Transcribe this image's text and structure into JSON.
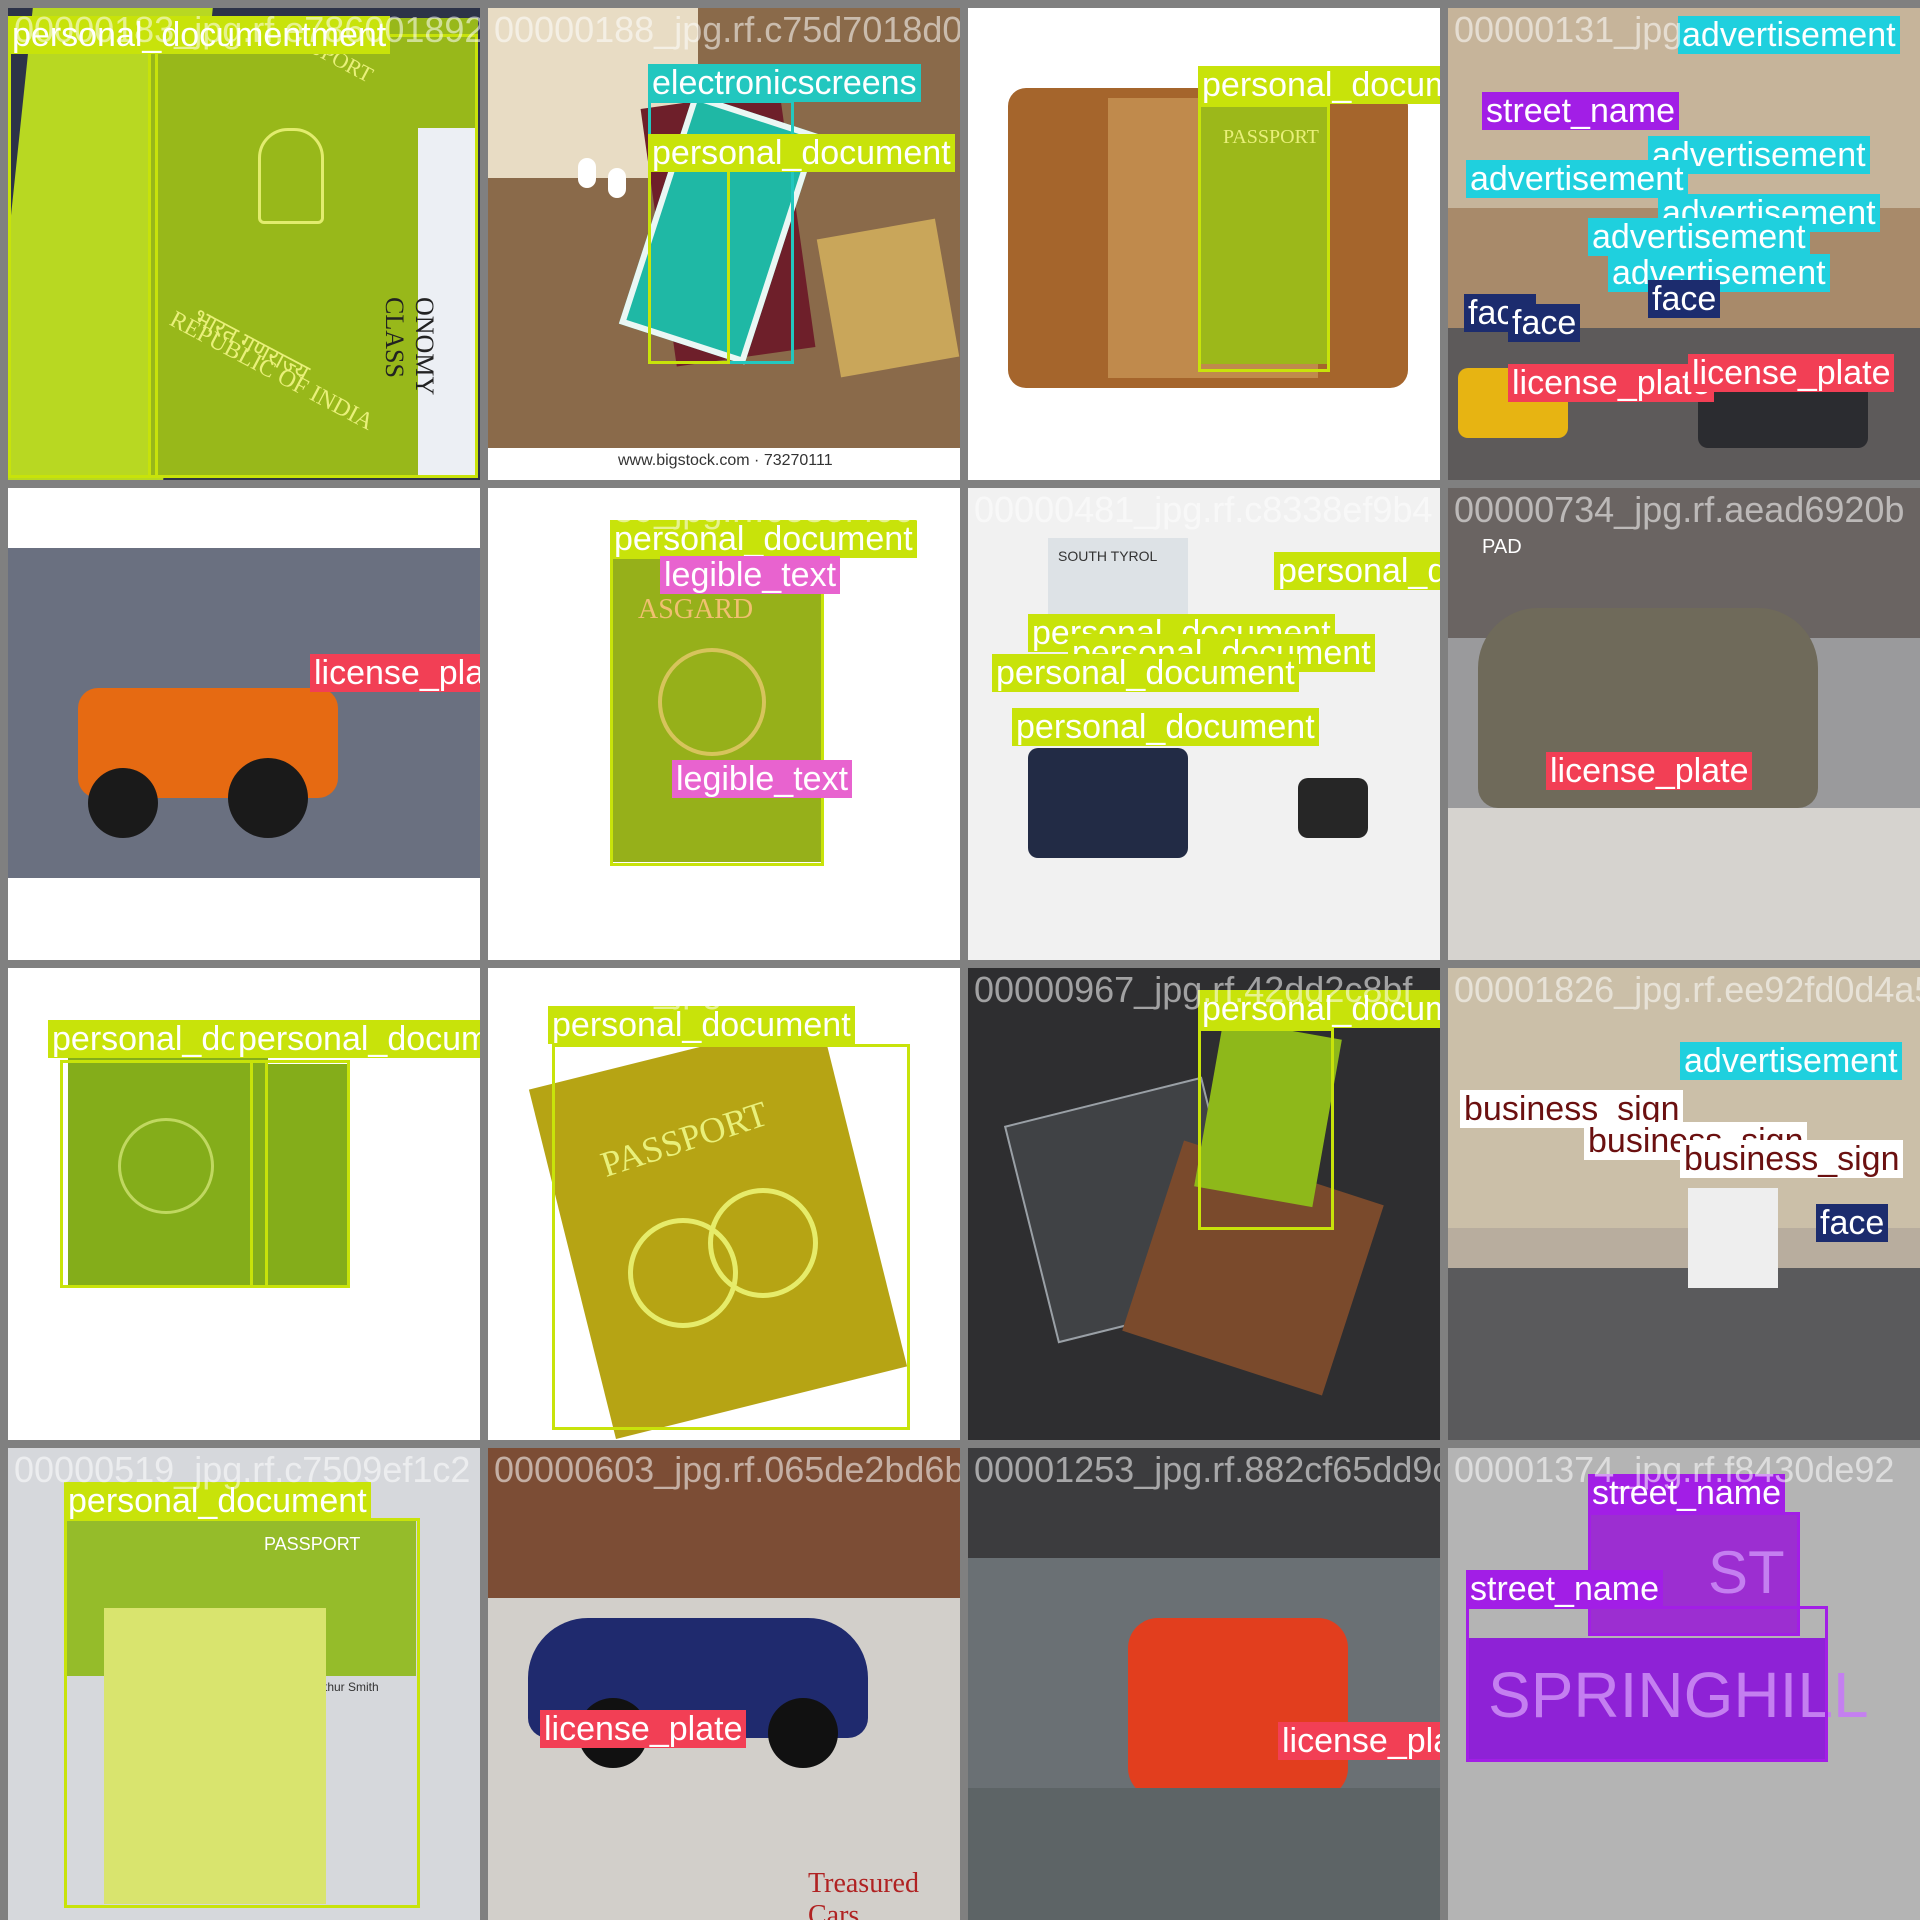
{
  "colors": {
    "personal_document": "#c8e30a",
    "electronicscreens": "#22c7bf",
    "street_name": "#a21ee6",
    "advertisement": "#1fd0de",
    "face": "#1c2c6e",
    "license_plate": "#f23f55",
    "legible_text": "#e863cf",
    "business_sign": "#ffffff",
    "background": "#808080"
  },
  "tiles": [
    {
      "filename": "00000183_jpg.rf.e786001892ca0732ea75d7018d0f",
      "labels": [
        "personal_documentment"
      ],
      "photo_text": [
        "REPUBLIC OF INDIA",
        "भारत गणराज्य",
        "SPORT",
        "ONOMY CLASS"
      ]
    },
    {
      "filename": "00000188_jpg.rf.c75d7018d0f0960657899",
      "labels": [
        "electronicscreens",
        "personal_document"
      ],
      "photo_text": [
        "www.bigstock.com · 73270111"
      ]
    },
    {
      "filename": "00000899_jpg.rf.f5b028f96b",
      "labels": [
        "personal_document"
      ],
      "photo_text": [
        "PASSPORT"
      ]
    },
    {
      "filename": "00000131_jpg",
      "labels": [
        "advertisement",
        "street_name",
        "advertisement",
        "advertisement",
        "advertisement",
        "advertisement",
        "advertisement",
        "advertisement",
        "face",
        "face",
        "face",
        "license_plate",
        "license_plate"
      ],
      "photo_text": []
    },
    {
      "filename": "00000482_jpg.rf.46d4d933c0",
      "labels": [
        "license_plate"
      ],
      "photo_text": []
    },
    {
      "filename": "00000459_jpg.rf.6e8ef40c8ba8ce6",
      "labels": [
        "personal_document",
        "legible_text",
        "legible_text"
      ],
      "photo_text": [
        "ASGARD"
      ]
    },
    {
      "filename": "00000481_jpg.rf.c8338ef9b4",
      "labels": [
        "personal_document",
        "personal_document",
        "personal_document",
        "personal_document",
        "personal_document"
      ],
      "photo_text": [
        "SOUTH TYROL"
      ]
    },
    {
      "filename": "00000734_jpg.rf.aead6920b",
      "labels": [
        "license_plate"
      ],
      "photo_text": [
        "PAD"
      ]
    },
    {
      "filename": "00000503_jpg.rf.899357edc0",
      "labels": [
        "personal_doc",
        "personal_document"
      ],
      "photo_text": []
    },
    {
      "filename": "00000988_jpg.rf.143314b2ae132",
      "labels": [
        "personal_document"
      ],
      "photo_text": [
        "PASSPORT"
      ]
    },
    {
      "filename": "00000967_jpg.rf.42dd2c8bf",
      "labels": [
        "personal_document"
      ],
      "photo_text": []
    },
    {
      "filename": "00001826_jpg.rf.ee92fd0d4a5694",
      "labels": [
        "advertisement",
        "business_sign",
        "business_sign",
        "business_sign",
        "face"
      ],
      "photo_text": []
    },
    {
      "filename": "00000519_jpg.rf.c7509ef1c2",
      "labels": [
        "personal_document"
      ],
      "photo_text": [
        "PASSPORT",
        "Arthur Smith"
      ]
    },
    {
      "filename": "00000603_jpg.rf.065de2bd6b4",
      "labels": [
        "license_plate"
      ],
      "photo_text": [
        "Treasured Cars"
      ]
    },
    {
      "filename": "00001253_jpg.rf.882cf65dd9c3",
      "labels": [
        "license_plate"
      ],
      "photo_text": []
    },
    {
      "filename": "00001374_jpg.rf.f8430de92",
      "labels": [
        "street_name",
        "street_name"
      ],
      "photo_text": [
        "ST",
        "SPRINGHILL"
      ]
    }
  ]
}
